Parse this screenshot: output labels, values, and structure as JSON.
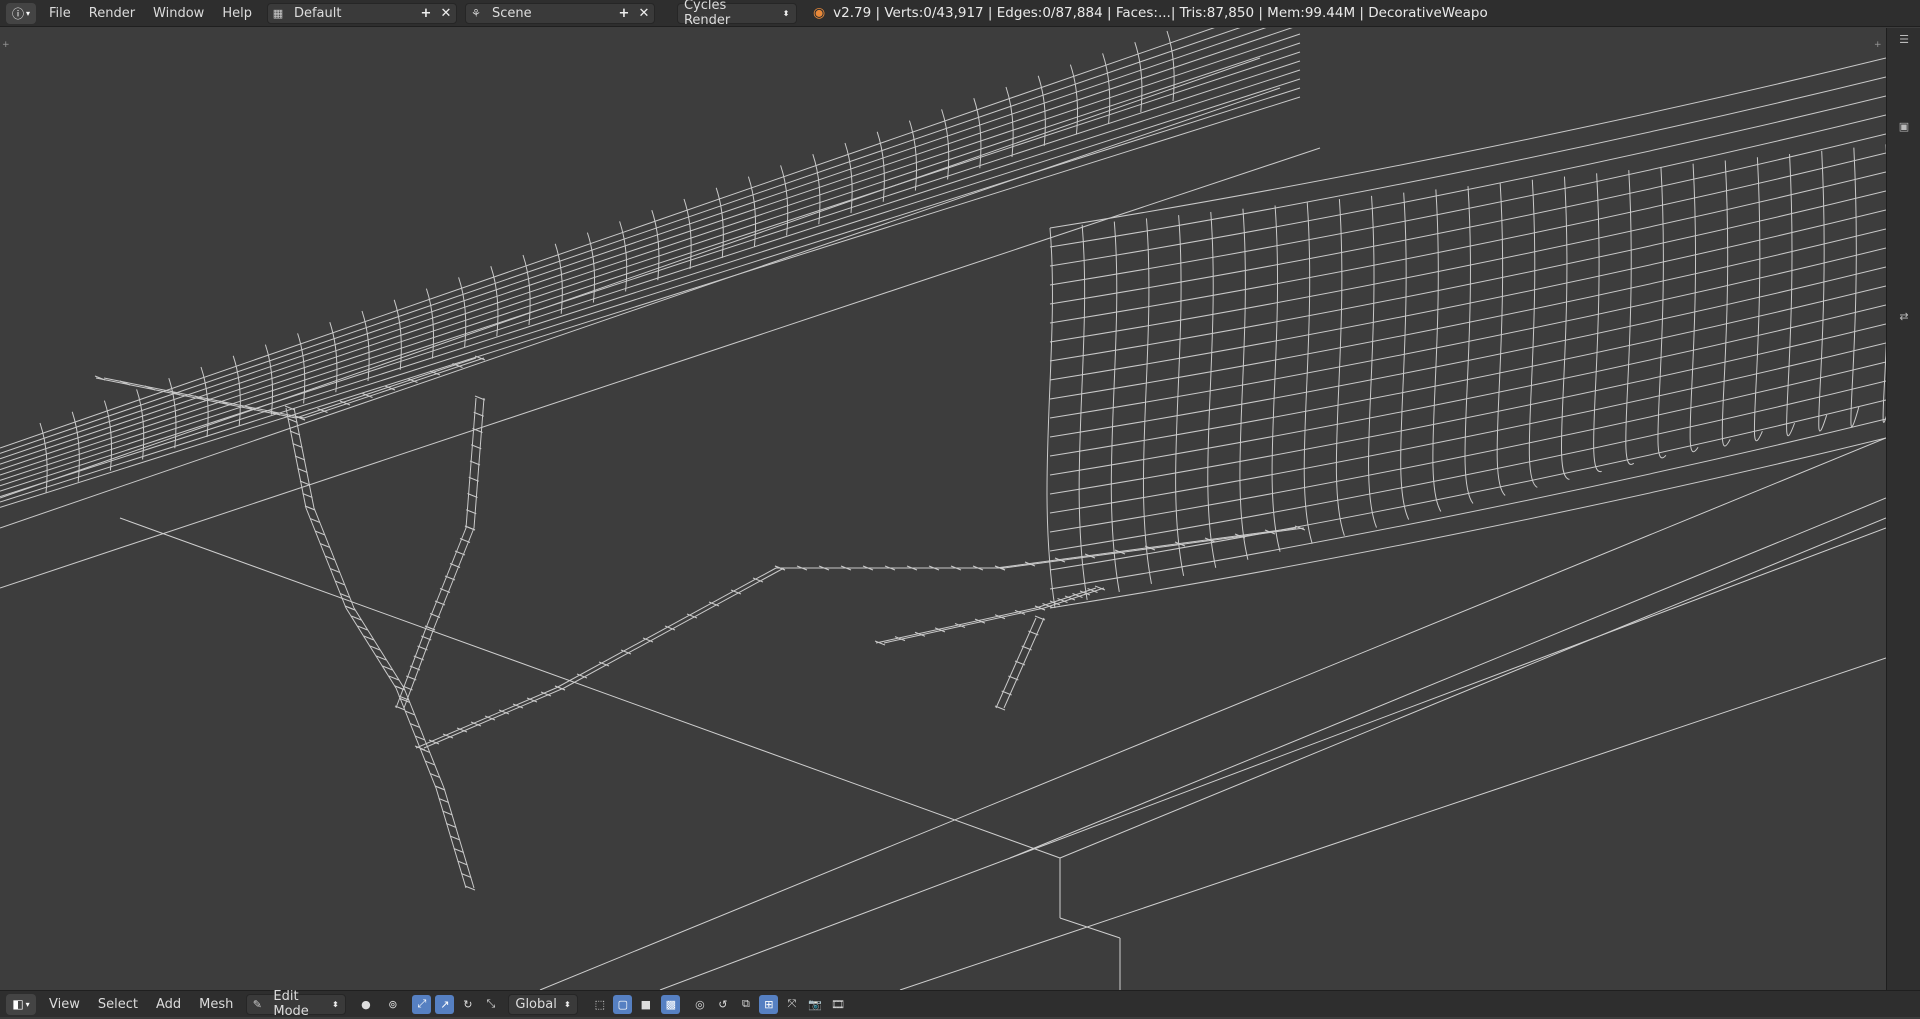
{
  "topbar": {
    "info_icon": "info-icon",
    "menus": [
      "File",
      "Render",
      "Window",
      "Help"
    ],
    "screen_layout": "Default",
    "scene": "Scene",
    "render_engine": "Cycles Render",
    "stats": "v2.79 | Verts:0/43,917 | Edges:0/87,884 | Faces:...| Tris:87,850 | Mem:99.44M | DecorativeWeapo"
  },
  "bottombar": {
    "menus": [
      "View",
      "Select",
      "Add",
      "Mesh"
    ],
    "mode": "Edit Mode",
    "orientation": "Global"
  },
  "colors": {
    "viewport_bg": "#3d3d3d",
    "wire": "#d9d9d9",
    "header_bg": "#2e2e2e",
    "active_tool": "#5680c2"
  }
}
